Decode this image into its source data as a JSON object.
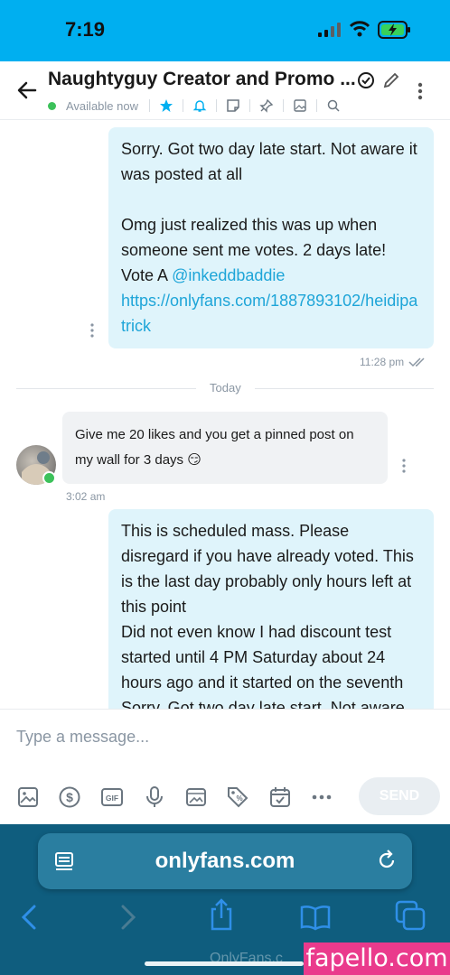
{
  "status_bar": {
    "time": "7:19"
  },
  "chat_header": {
    "title": "Naughtyguy Creator and Promo ...",
    "presence": "Available now"
  },
  "messages": {
    "outgoing_1": {
      "line1": "Sorry. Got two day late start. Not aware it was posted at all",
      "line2": "Omg just realized this was up when someone sent me votes. 2 days late! Vote A",
      "mention": "@inkeddbaddie",
      "link": "https://onlyfans.com/1887893102/heidipatrick",
      "time": "11:28 pm"
    },
    "day_divider": "Today",
    "incoming_1": {
      "text": "Give me 20 likes and you get a pinned post on my wall for 3 days 😏",
      "time": "3:02 am"
    },
    "outgoing_2": {
      "text": "This is scheduled mass. Please disregard if you have already voted. This is the last day probably only hours left at this point",
      "text2": "Did not even know I had discount test started until 4 PM Saturday about 24 hours ago and it started on the seventh",
      "text3": "Sorry. Got two day late start. Not aware"
    }
  },
  "composer": {
    "placeholder": "Type a message...",
    "send_label": "SEND",
    "tools": [
      "image-icon",
      "dollar-icon",
      "gif-icon",
      "microphone-icon",
      "media-vault-icon",
      "price-tag-icon",
      "calendar-icon",
      "more-icon"
    ]
  },
  "browser": {
    "url": "onlyfans.com",
    "ghost_text": "OnlyFans.c"
  },
  "watermark": "fapello.com",
  "colors": {
    "brand": "#00aff0",
    "outgoing_bubble": "#dff4fb",
    "incoming_bubble": "#f0f2f4",
    "online": "#3cc15a",
    "link": "#1ea5d8",
    "safari_bar": "#0f5d7e"
  }
}
